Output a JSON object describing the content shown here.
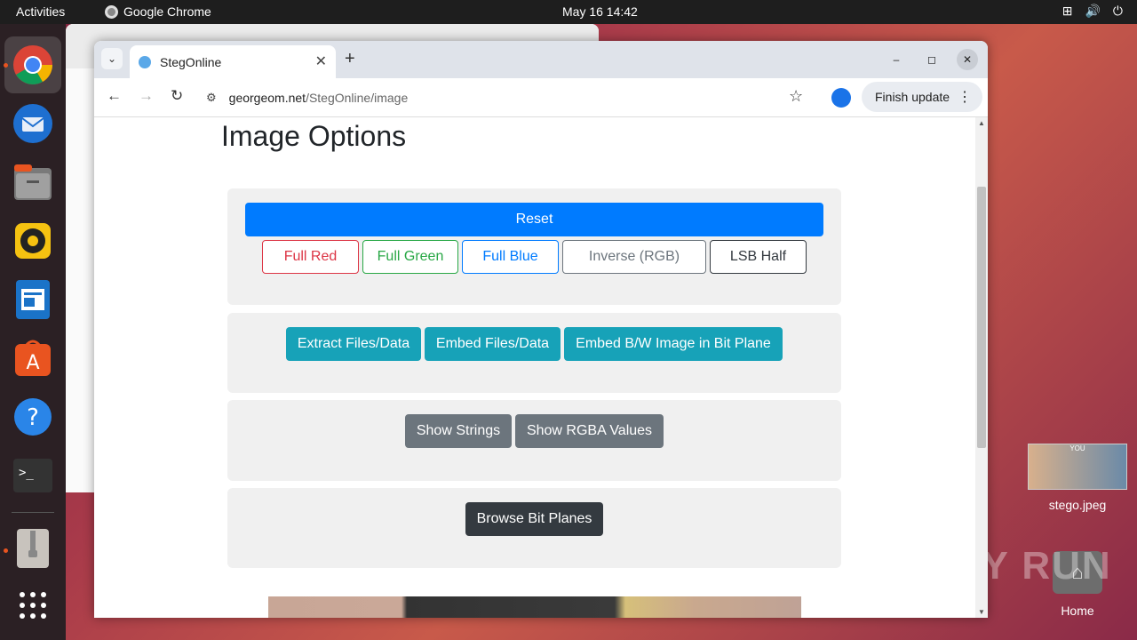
{
  "topbar": {
    "activities": "Activities",
    "app_name": "Google Chrome",
    "clock": "May 16  14:42"
  },
  "desktop": {
    "file_icon_label": "stego.jpeg",
    "file_thumb_text": "YOU",
    "home_label": "Home",
    "watermark": "ANY RUN"
  },
  "browser": {
    "tab_title": "StegOnline",
    "url_host": "georgeom.net",
    "url_path": "/StegOnline/image",
    "update_label": "Finish update"
  },
  "page": {
    "title": "Image Options",
    "panel1": {
      "reset": "Reset",
      "full_red": "Full Red",
      "full_green": "Full Green",
      "full_blue": "Full Blue",
      "inverse": "Inverse (RGB)",
      "lsb_half": "LSB Half"
    },
    "panel2": {
      "extract": "Extract Files/Data",
      "embed": "Embed Files/Data",
      "embed_bw": "Embed B/W Image in Bit Plane"
    },
    "panel3": {
      "strings": "Show Strings",
      "rgba": "Show RGBA Values"
    },
    "panel4": {
      "bitplanes": "Browse Bit Planes"
    }
  },
  "colors": {
    "primary": "#007bff",
    "danger": "#dc3545",
    "success": "#28a745",
    "info": "#17a2b8",
    "secondary": "#6c757d",
    "dark": "#343a40"
  }
}
